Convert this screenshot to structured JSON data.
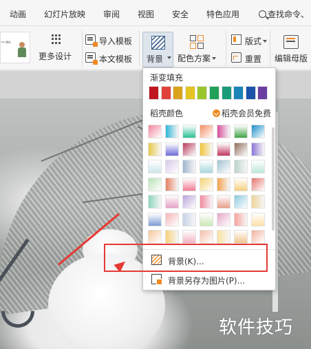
{
  "menu": {
    "items": [
      "动画",
      "幻灯片放映",
      "审阅",
      "视图",
      "安全",
      "特色应用"
    ],
    "search_label": "查找命令、"
  },
  "ribbon": {
    "thumbnail_text": "PPT模板",
    "more_design": "更多设计",
    "import_template": "导入模板",
    "text_template": "本文模板",
    "background": "背景",
    "color_scheme": "配色方案",
    "layout": "版式",
    "reset": "重置",
    "edit_master": "编辑母版"
  },
  "dropdown": {
    "gradient_fill_title": "渐变填充",
    "straw_colors_title": "稻壳颜色",
    "vip_free": "稻壳会员免费",
    "solid_colors": [
      "#c0161f",
      "#e0413a",
      "#d9a31b",
      "#e3c421",
      "#9ac52d",
      "#22a15a",
      "#1a9b79",
      "#1b84b8",
      "#1b54a8",
      "#6a3ea1"
    ],
    "gradient_swatches": [
      [
        "#f2849b",
        "#2fb6d8",
        "#2bbf95",
        "#f38d63",
        "#d84f9a",
        "#43a447",
        "#1c8fc8"
      ],
      [
        "#e6c94a",
        "#6f6ad8",
        "#b63c5c",
        "#f2c63a",
        "#c0365f",
        "#8f6d5a",
        "#8b77d6"
      ],
      [
        "#cfe7ec",
        "#d8c9ea",
        "#9fb6cf",
        "#a8d7dd",
        "#9fc3cf",
        "#bcd2cc",
        "#bde8d8"
      ],
      [
        "#b9e2b7",
        "#e58060",
        "#f07b92",
        "#f4d273",
        "#f3a34c",
        "#f7cf7f",
        "#e4736e"
      ],
      [
        "#8fd3c0",
        "#e8a2c6",
        "#b9a4d9",
        "#f28aa1",
        "#e6a08a",
        "#8bc9e0",
        "#f0d39a"
      ],
      [
        "#7e9dd4",
        "#f4b6b8",
        "#c7d3e8",
        "#cbe8b4",
        "#e5a6c7",
        "#f7a3a0",
        "#fde1a8"
      ],
      [
        "#f5c79f",
        "#f7d07a",
        "#f1b3c0",
        "#f4bfa9",
        "#f9e3a0",
        "#f1c48f",
        "#f2b2a0"
      ]
    ],
    "item_background": "背景(K)...",
    "item_save_as_image": "背景另存为图片(P)..."
  },
  "watermark": "软件技巧",
  "colors": {
    "highlight_red": "#e53935",
    "accent_orange": "#f08a24"
  }
}
